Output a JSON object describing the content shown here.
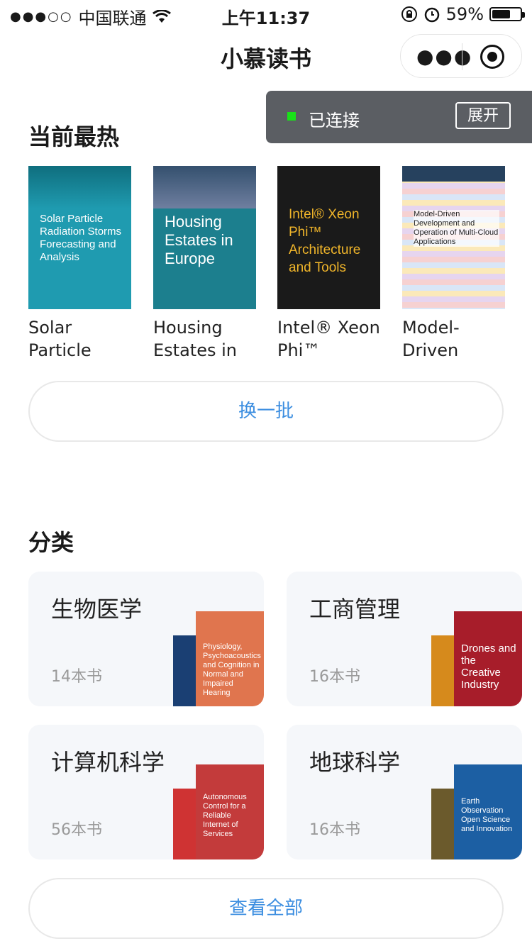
{
  "status_bar": {
    "carrier": "中国联通",
    "time": "上午11:37",
    "battery": "59%",
    "signal_icon": "signal-dots-icon",
    "wifi_icon": "wifi-icon"
  },
  "nav": {
    "title": "小慕读书",
    "more_icon": "more-dots-icon",
    "close_icon": "target-circle-icon"
  },
  "toast": {
    "status": "已连接",
    "expand_label": "展开",
    "dot_color": "#19e019"
  },
  "hot": {
    "heading": "当前最热",
    "books": [
      {
        "title_line1": "Solar",
        "title_line2": "Particle",
        "cover_title": "Solar Particle Radiation Storms Forecasting and Analysis",
        "cover_color": "#1f9bb0"
      },
      {
        "title_line1": "Housing",
        "title_line2": "Estates in",
        "cover_title": "Housing Estates in Europe",
        "cover_color": "#1c7f8e"
      },
      {
        "title_line1": "Intel® Xeon",
        "title_line2": "Phi™",
        "cover_title": "Intel® Xeon Phi™ Architecture and Tools",
        "cover_color": "#1a1a1a"
      },
      {
        "title_line1": "Model-",
        "title_line2": "Driven",
        "cover_title": "Model-Driven Development and Operation of Multi-Cloud Applications",
        "cover_color": "#f2f2f2"
      }
    ],
    "refresh_label": "换一批"
  },
  "categories": {
    "heading": "分类",
    "items": [
      {
        "name": "生物医学",
        "count": "14本书",
        "front_cover": "Physiology, Psychoacoustics and Cognition in Normal and Impaired Hearing",
        "front_color": "#e0754e",
        "back_color": "#1a3f73"
      },
      {
        "name": "工商管理",
        "count": "16本书",
        "front_cover": "Drones and the Creative Industry",
        "front_color": "#a71d2a",
        "back_color": "#d68a1c"
      },
      {
        "name": "计算机科学",
        "count": "56本书",
        "front_cover": "Autonomous Control for a Reliable Internet of Services",
        "front_color": "#c33b3b",
        "back_color": "#cf3333"
      },
      {
        "name": "地球科学",
        "count": "16本书",
        "front_cover": "Earth Observation Open Science and Innovation",
        "front_color": "#1c5fa3",
        "back_color": "#6b5a2c"
      }
    ],
    "view_all_label": "查看全部"
  }
}
